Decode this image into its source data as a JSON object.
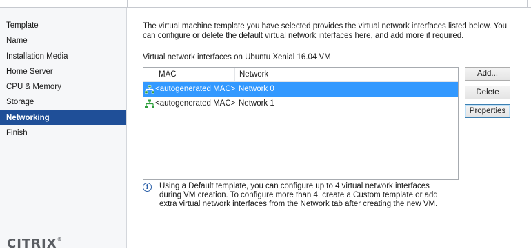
{
  "sidebar": {
    "items": [
      {
        "label": "Template",
        "active": false
      },
      {
        "label": "Name",
        "active": false
      },
      {
        "label": "Installation Media",
        "active": false
      },
      {
        "label": "Home Server",
        "active": false
      },
      {
        "label": "CPU & Memory",
        "active": false
      },
      {
        "label": "Storage",
        "active": false
      },
      {
        "label": "Networking",
        "active": true
      },
      {
        "label": "Finish",
        "active": false
      }
    ],
    "logo_text": "CITRIX",
    "logo_mark": "®"
  },
  "main": {
    "intro": "The virtual machine template you have selected provides the virtual network interfaces listed below. You can configure or delete the default virtual network interfaces here, and add more if required.",
    "list_caption": "Virtual network interfaces on Ubuntu Xenial 16.04 VM",
    "columns": {
      "mac": "MAC",
      "network": "Network"
    },
    "rows": [
      {
        "mac": "<autogenerated MAC>",
        "network": "Network 0",
        "selected": true,
        "icon": "network-interface-icon"
      },
      {
        "mac": "<autogenerated MAC>",
        "network": "Network 1",
        "selected": false,
        "icon": "network-interface-icon"
      }
    ],
    "buttons": {
      "add": "Add...",
      "delete": "Delete",
      "properties": "Properties"
    },
    "info_icon": "info-icon",
    "info": "Using a Default template, you can configure up to 4 virtual network interfaces during VM creation. To configure more than 4, create a Custom template or add extra virtual network interfaces from the Network tab after creating the new VM."
  },
  "colors": {
    "active_nav": "#1f4f98",
    "selected_row": "#3399ff",
    "icon_green": "#2e9e3c"
  }
}
